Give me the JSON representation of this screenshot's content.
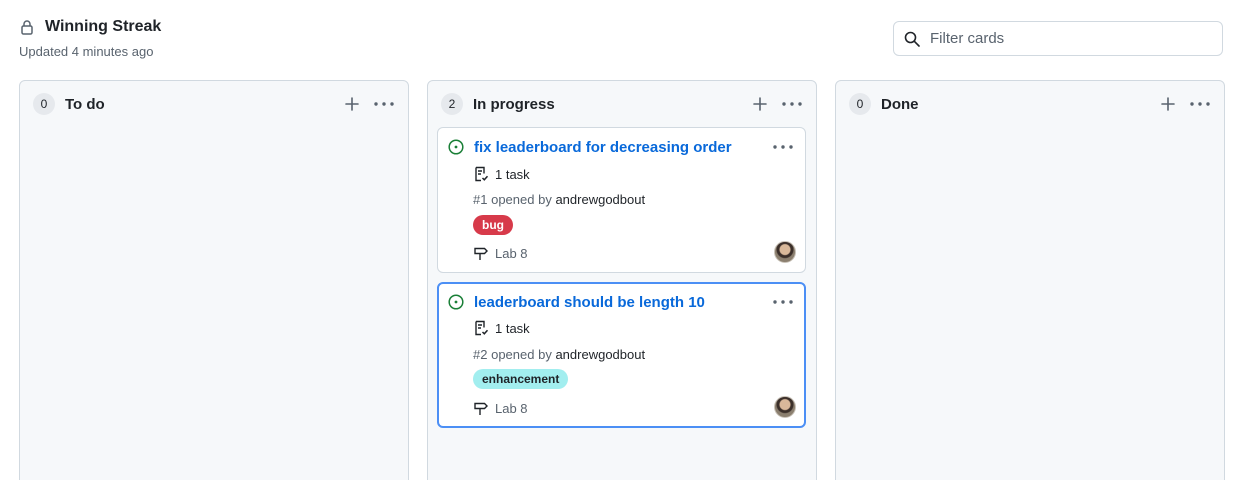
{
  "project": {
    "title": "Winning Streak",
    "updated": "Updated 4 minutes ago"
  },
  "filter": {
    "placeholder": "Filter cards"
  },
  "columns": [
    {
      "count": "0",
      "title": "To do"
    },
    {
      "count": "2",
      "title": "In progress"
    },
    {
      "count": "0",
      "title": "Done"
    }
  ],
  "cards": [
    {
      "title": "fix leaderboard for decreasing order",
      "tasks": "1 task",
      "number": "#1",
      "opened_by": "opened by",
      "author": "andrewgodbout",
      "label": "bug",
      "milestone": "Lab 8"
    },
    {
      "title": "leaderboard should be length 10",
      "tasks": "1 task",
      "number": "#2",
      "opened_by": "opened by",
      "author": "andrewgodbout",
      "label": "enhancement",
      "milestone": "Lab 8"
    }
  ],
  "colors": {
    "accent": "#0969da",
    "open_issue": "#1a7f37",
    "bug_label": "#d73a4a",
    "enhancement_label": "#a2eeef",
    "selected_border": "#4c8ff5"
  },
  "icons": [
    "lock-icon",
    "search-icon",
    "plus-icon",
    "kebab-icon",
    "issue-opened-icon",
    "task-list-icon",
    "milestone-icon"
  ]
}
